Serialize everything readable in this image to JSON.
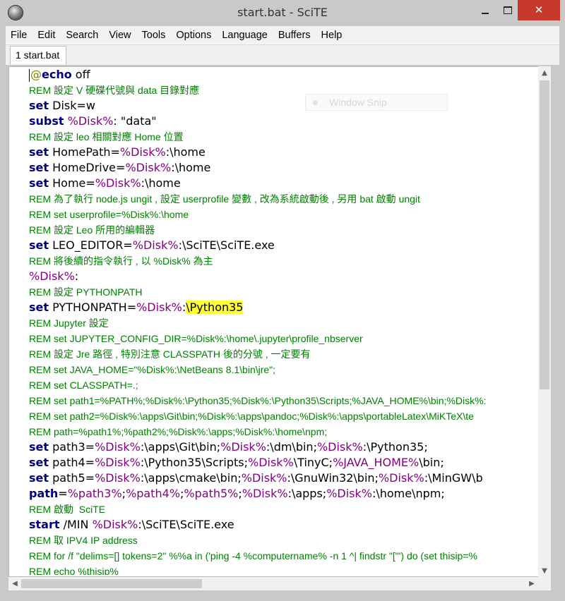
{
  "window": {
    "title": "start.bat - SciTE",
    "minimize_glyph": "",
    "maximize_glyph": "",
    "close_glyph": "✕"
  },
  "menu": [
    "File",
    "Edit",
    "Search",
    "View",
    "Tools",
    "Options",
    "Language",
    "Buffers",
    "Help"
  ],
  "tabs": [
    {
      "label": "1 start.bat"
    }
  ],
  "overlay": {
    "text": "Window Snip"
  },
  "icons": {
    "app": "scite-app-icon",
    "scroll_up": "▲",
    "scroll_down": "▼",
    "scroll_left": "◀",
    "scroll_right": "▶"
  },
  "colors": {
    "keyword": "#00007f",
    "variable": "#7f007f",
    "comment": "#007f00",
    "highlight": "#ffff33",
    "close_button": "#c7392b"
  },
  "scroll": {
    "vertical_position": 0.0,
    "horizontal_position": 0.0
  },
  "code_lines": [
    {
      "kind": "stmt",
      "parts": [
        {
          "t": "at",
          "v": "@"
        },
        {
          "t": "kw",
          "v": "echo"
        },
        {
          "t": "p",
          "v": " off"
        }
      ]
    },
    {
      "kind": "rem",
      "parts": [
        {
          "t": "p",
          "v": "REM 設定 V 硬碟代號與 data 目錄對應"
        }
      ]
    },
    {
      "kind": "stmt",
      "parts": [
        {
          "t": "kw",
          "v": "set"
        },
        {
          "t": "p",
          "v": " Disk=w"
        }
      ]
    },
    {
      "kind": "stmt",
      "parts": [
        {
          "t": "kw",
          "v": "subst"
        },
        {
          "t": "p",
          "v": " "
        },
        {
          "t": "var",
          "v": "%Disk%"
        },
        {
          "t": "p",
          "v": ": \"data\""
        }
      ]
    },
    {
      "kind": "rem",
      "parts": [
        {
          "t": "p",
          "v": "REM 設定 leo 相關對應 Home 位置"
        }
      ]
    },
    {
      "kind": "stmt",
      "parts": [
        {
          "t": "kw",
          "v": "set"
        },
        {
          "t": "p",
          "v": " HomePath="
        },
        {
          "t": "var",
          "v": "%Disk%"
        },
        {
          "t": "p",
          "v": ":\\home"
        }
      ]
    },
    {
      "kind": "stmt",
      "parts": [
        {
          "t": "kw",
          "v": "set"
        },
        {
          "t": "p",
          "v": " HomeDrive="
        },
        {
          "t": "var",
          "v": "%Disk%"
        },
        {
          "t": "p",
          "v": ":\\home"
        }
      ]
    },
    {
      "kind": "stmt",
      "parts": [
        {
          "t": "kw",
          "v": "set"
        },
        {
          "t": "p",
          "v": " Home="
        },
        {
          "t": "var",
          "v": "%Disk%"
        },
        {
          "t": "p",
          "v": ":\\home"
        }
      ]
    },
    {
      "kind": "rem",
      "parts": [
        {
          "t": "p",
          "v": "REM 為了執行 node.js ungit , 設定 userprofile 變數 , 改為系統啟動後 , 另用 bat 啟動 ungit"
        }
      ]
    },
    {
      "kind": "rem",
      "parts": [
        {
          "t": "p",
          "v": "REM set userprofile=%Disk%:\\home"
        }
      ]
    },
    {
      "kind": "rem",
      "parts": [
        {
          "t": "p",
          "v": "REM 設定 Leo 所用的編輯器"
        }
      ]
    },
    {
      "kind": "stmt",
      "parts": [
        {
          "t": "kw",
          "v": "set"
        },
        {
          "t": "p",
          "v": " LEO_EDITOR="
        },
        {
          "t": "var",
          "v": "%Disk%"
        },
        {
          "t": "p",
          "v": ":\\SciTE\\SciTE.exe"
        }
      ]
    },
    {
      "kind": "rem",
      "parts": [
        {
          "t": "p",
          "v": "REM 將後續的指令執行 , 以 %Disk% 為主"
        }
      ]
    },
    {
      "kind": "stmt",
      "parts": [
        {
          "t": "var",
          "v": "%Disk%"
        },
        {
          "t": "p",
          "v": ":"
        }
      ]
    },
    {
      "kind": "rem",
      "parts": [
        {
          "t": "p",
          "v": "REM 設定 PYTHONPATH"
        }
      ]
    },
    {
      "kind": "stmt",
      "parts": [
        {
          "t": "kw",
          "v": "set"
        },
        {
          "t": "p",
          "v": " PYTHONPATH="
        },
        {
          "t": "var",
          "v": "%Disk%"
        },
        {
          "t": "p",
          "v": ":"
        },
        {
          "t": "hl",
          "v": "\\Python35"
        }
      ]
    },
    {
      "kind": "rem",
      "parts": [
        {
          "t": "p",
          "v": "REM Jupyter 設定"
        }
      ]
    },
    {
      "kind": "rem",
      "parts": [
        {
          "t": "p",
          "v": "REM set JUPYTER_CONFIG_DIR=%Disk%:\\home\\.jupyter\\profile_nbserver"
        }
      ]
    },
    {
      "kind": "rem",
      "parts": [
        {
          "t": "p",
          "v": "REM 設定 Jre 路徑 , 特別注意 CLASSPATH 後的分號 , 一定要有"
        }
      ]
    },
    {
      "kind": "rem",
      "parts": [
        {
          "t": "p",
          "v": "REM set JAVA_HOME=\"%Disk%:\\NetBeans 8.1\\bin\\jre\";"
        }
      ]
    },
    {
      "kind": "rem",
      "parts": [
        {
          "t": "p",
          "v": "REM set CLASSPATH=.;"
        }
      ]
    },
    {
      "kind": "rem",
      "parts": [
        {
          "t": "p",
          "v": "REM set path1=%PATH%;%Disk%:\\Python35;%Disk%:\\Python35\\Scripts;%JAVA_HOME%\\bin;%Disk%:"
        }
      ]
    },
    {
      "kind": "rem",
      "parts": [
        {
          "t": "p",
          "v": "REM set path2=%Disk%:\\apps\\Git\\bin;%Disk%:\\apps\\pandoc;%Disk%:\\apps\\portableLatex\\MiKTeX\\te"
        }
      ]
    },
    {
      "kind": "rem",
      "parts": [
        {
          "t": "p",
          "v": "REM path=%path1%;%path2%;%Disk%:\\apps;%Disk%:\\home\\npm;"
        }
      ]
    },
    {
      "kind": "stmt",
      "parts": [
        {
          "t": "kw",
          "v": "set"
        },
        {
          "t": "p",
          "v": " path3="
        },
        {
          "t": "var",
          "v": "%Disk%"
        },
        {
          "t": "p",
          "v": ":\\apps\\Git\\bin;"
        },
        {
          "t": "var",
          "v": "%Disk%"
        },
        {
          "t": "p",
          "v": ":\\dm\\bin;"
        },
        {
          "t": "var",
          "v": "%Disk%"
        },
        {
          "t": "p",
          "v": ":\\Python35;"
        }
      ]
    },
    {
      "kind": "stmt",
      "parts": [
        {
          "t": "kw",
          "v": "set"
        },
        {
          "t": "p",
          "v": " path4="
        },
        {
          "t": "var",
          "v": "%Disk%"
        },
        {
          "t": "p",
          "v": ":\\Python35\\Scripts;"
        },
        {
          "t": "var",
          "v": "%Disk%"
        },
        {
          "t": "p",
          "v": "\\TinyC;"
        },
        {
          "t": "var",
          "v": "%JAVA_HOME%"
        },
        {
          "t": "p",
          "v": "\\bin;"
        }
      ]
    },
    {
      "kind": "stmt",
      "parts": [
        {
          "t": "kw",
          "v": "set"
        },
        {
          "t": "p",
          "v": " path5="
        },
        {
          "t": "var",
          "v": "%Disk%"
        },
        {
          "t": "p",
          "v": ":\\apps\\cmake\\bin;"
        },
        {
          "t": "var",
          "v": "%Disk%"
        },
        {
          "t": "p",
          "v": ":\\GnuWin32\\bin;"
        },
        {
          "t": "var",
          "v": "%Disk%"
        },
        {
          "t": "p",
          "v": ":\\MinGW\\b"
        }
      ]
    },
    {
      "kind": "stmt",
      "parts": [
        {
          "t": "kw",
          "v": "path"
        },
        {
          "t": "p",
          "v": "="
        },
        {
          "t": "var",
          "v": "%path3%"
        },
        {
          "t": "p",
          "v": ";"
        },
        {
          "t": "var",
          "v": "%path4%"
        },
        {
          "t": "p",
          "v": ";"
        },
        {
          "t": "var",
          "v": "%path5%"
        },
        {
          "t": "p",
          "v": ";"
        },
        {
          "t": "var",
          "v": "%Disk%"
        },
        {
          "t": "p",
          "v": ":\\apps;"
        },
        {
          "t": "var",
          "v": "%Disk%"
        },
        {
          "t": "p",
          "v": ":\\home\\npm;"
        }
      ]
    },
    {
      "kind": "rem",
      "parts": [
        {
          "t": "p",
          "v": "REM 啟動  SciTE"
        }
      ]
    },
    {
      "kind": "stmt",
      "parts": [
        {
          "t": "kw",
          "v": "start"
        },
        {
          "t": "p",
          "v": " /MIN "
        },
        {
          "t": "var",
          "v": "%Disk%"
        },
        {
          "t": "p",
          "v": ":\\SciTE\\SciTE.exe"
        }
      ]
    },
    {
      "kind": "rem",
      "parts": [
        {
          "t": "p",
          "v": "REM 取 IPV4 IP address"
        }
      ]
    },
    {
      "kind": "rem",
      "parts": [
        {
          "t": "p",
          "v": "REM for /f \"delims=[] tokens=2\" %%a in ('ping -4 %computername% -n 1 ^| findstr \"[\"') do (set thisip=%"
        }
      ]
    },
    {
      "kind": "rem",
      "parts": [
        {
          "t": "p",
          "v": "REM echo %thisip%"
        }
      ]
    }
  ]
}
